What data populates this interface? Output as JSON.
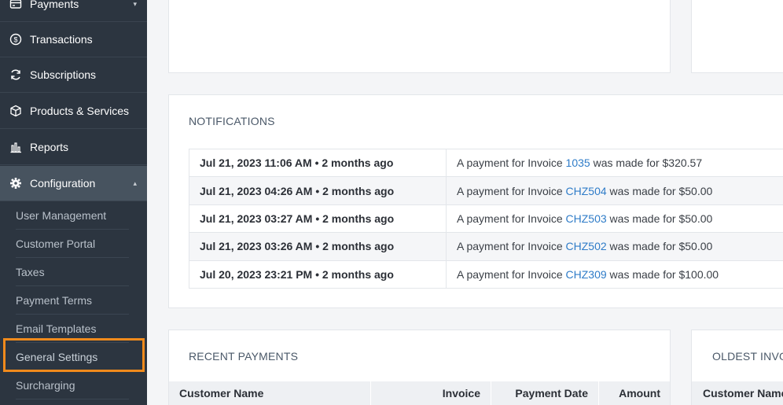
{
  "sidebar": {
    "items": [
      {
        "label": "Payments",
        "icon": "payments-icon"
      },
      {
        "label": "Transactions",
        "icon": "dollar-circle-icon"
      },
      {
        "label": "Subscriptions",
        "icon": "refresh-icon"
      },
      {
        "label": "Products & Services",
        "icon": "box-icon"
      },
      {
        "label": "Reports",
        "icon": "bar-chart-icon"
      },
      {
        "label": "Configuration",
        "icon": "gear-icon"
      }
    ],
    "config_items": [
      "User Management",
      "Customer Portal",
      "Taxes",
      "Payment Terms",
      "Email Templates",
      "General Settings",
      "Surcharging"
    ]
  },
  "notifications": {
    "title": "NOTIFICATIONS",
    "rows": [
      {
        "date": "Jul 21, 2023 11:06 AM • 2 months ago",
        "prefix": "A payment for Invoice ",
        "invoice": "1035",
        "suffix": " was made for $320.57"
      },
      {
        "date": "Jul 21, 2023 04:26 AM • 2 months ago",
        "prefix": "A payment for Invoice ",
        "invoice": "CHZ504",
        "suffix": " was made for $50.00"
      },
      {
        "date": "Jul 21, 2023 03:27 AM • 2 months ago",
        "prefix": "A payment for Invoice ",
        "invoice": "CHZ503",
        "suffix": " was made for $50.00"
      },
      {
        "date": "Jul 21, 2023 03:26 AM • 2 months ago",
        "prefix": "A payment for Invoice ",
        "invoice": "CHZ502",
        "suffix": " was made for $50.00"
      },
      {
        "date": "Jul 20, 2023 23:21 PM • 2 months ago",
        "prefix": "A payment for Invoice ",
        "invoice": "CHZ309",
        "suffix": " was made for $100.00"
      }
    ]
  },
  "recent_payments": {
    "title": "RECENT PAYMENTS",
    "columns": [
      "Customer Name",
      "Invoice",
      "Payment Date",
      "Amount"
    ]
  },
  "oldest_invoices": {
    "title": "OLDEST INVO",
    "columns": [
      "Customer Name"
    ]
  },
  "colors": {
    "sidebar_bg": "#2c3540",
    "link": "#2f7cc8",
    "highlight": "#f08a1c"
  }
}
